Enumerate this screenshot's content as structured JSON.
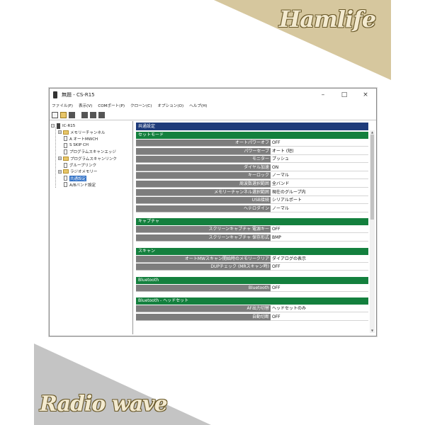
{
  "brand": {
    "top": "Hamlife",
    "bottom": "Radio wave"
  },
  "colors": {
    "top_banner": "#d6c79e",
    "bottom_banner": "#c4c4c4",
    "section_green": "#14803e",
    "header_navy": "#1e3b7a",
    "label_gray": "#7d7d7d"
  },
  "window": {
    "title": "無題 - CS-R15",
    "controls": {
      "minimize": "–",
      "maximize": "□",
      "close": "×"
    }
  },
  "menu": [
    "ファイル(F)",
    "表示(V)",
    "COMポート(P)",
    "クローン(C)",
    "オプション(O)",
    "ヘルプ(H)"
  ],
  "toolbar": [
    "new-icon",
    "open-icon",
    "save-icon",
    "read-radio-icon",
    "write-radio-icon",
    "clone-icon"
  ],
  "tree": {
    "root": "IC-R15",
    "items": [
      {
        "label": "メモリーチャンネル",
        "expander": "+",
        "icon": "folder-icon"
      },
      {
        "label": "A オートMWCH",
        "expander": "",
        "icon": "doc-icon"
      },
      {
        "label": "S SKIP CH",
        "expander": "",
        "icon": "doc-icon"
      },
      {
        "label": "プログラムスキャンエッジ",
        "expander": "",
        "icon": "doc-icon"
      },
      {
        "label": "プログラムスキャンリンク",
        "expander": "+",
        "icon": "folder-icon"
      },
      {
        "label": "グループリンク",
        "expander": "",
        "icon": "doc-icon"
      },
      {
        "label": "ラジオメモリー",
        "expander": "+",
        "icon": "folder-icon"
      },
      {
        "label": "共通設定",
        "expander": "",
        "icon": "doc-icon",
        "selected": true
      },
      {
        "label": "A/Bバンド設定",
        "expander": "",
        "icon": "doc-icon"
      }
    ]
  },
  "pane": {
    "header": "共通設定",
    "sections": [
      {
        "title": "セットモード",
        "rows": [
          {
            "label": "オートパワーオフ",
            "value": "OFF"
          },
          {
            "label": "パワーセーブ",
            "value": "オート (短)"
          },
          {
            "label": "モニター",
            "value": "プッシュ"
          },
          {
            "label": "ダイヤル加速",
            "value": "ON"
          },
          {
            "label": "キーロック",
            "value": "ノーマル"
          },
          {
            "label": "周波数選択範囲",
            "value": "全バンド"
          },
          {
            "label": "メモリーチャンネル選択範囲",
            "value": "現在のグループ内"
          },
          {
            "label": "USB接続",
            "value": "シリアルポート"
          },
          {
            "label": "ヘテロダイン",
            "value": "ノーマル"
          }
        ]
      },
      {
        "title": "キャプチャ",
        "rows": [
          {
            "label": "スクリーンキャプチャ 電源キー",
            "value": "OFF"
          },
          {
            "label": "スクリーンキャプチャ 保存形式",
            "value": "BMP"
          }
        ]
      },
      {
        "title": "スキャン",
        "rows": [
          {
            "label": "オートMWスキャン開始時のメモリークリア",
            "value": "ダイアログの表示"
          },
          {
            "label": "DUPチェック (MRスキャン時)",
            "value": "OFF"
          }
        ]
      },
      {
        "title": "Bluetooth",
        "rows": [
          {
            "label": "Bluetooth",
            "value": "OFF"
          }
        ]
      },
      {
        "title": "Bluetooth - ヘッドセット",
        "rows": [
          {
            "label": "AF出力切替",
            "value": "ヘッドセットのみ"
          },
          {
            "label": "自動切断",
            "value": "OFF"
          }
        ]
      }
    ]
  }
}
